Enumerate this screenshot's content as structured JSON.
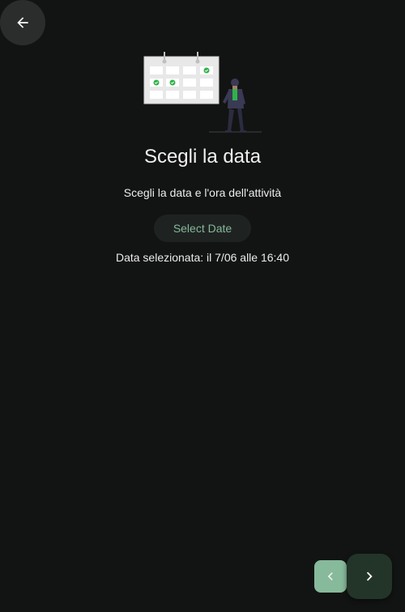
{
  "header": {
    "back_icon": "arrow-left-icon"
  },
  "illustration": {
    "name": "calendar-person-illustration"
  },
  "main": {
    "title": "Scegli la data",
    "subtitle": "Scegli la data e l'ora dell'attività",
    "select_date_label": "Select Date",
    "selected_date_text": "Data selezionata: il 7/06 alle 16:40"
  },
  "footer": {
    "prev_icon": "chevron-left-icon",
    "next_icon": "chevron-right-icon"
  },
  "colors": {
    "background": "#121413",
    "accent_green": "#2fb34a",
    "prev_button": "#87b99b",
    "next_button": "#233429",
    "select_date_text": "#86b79a"
  }
}
